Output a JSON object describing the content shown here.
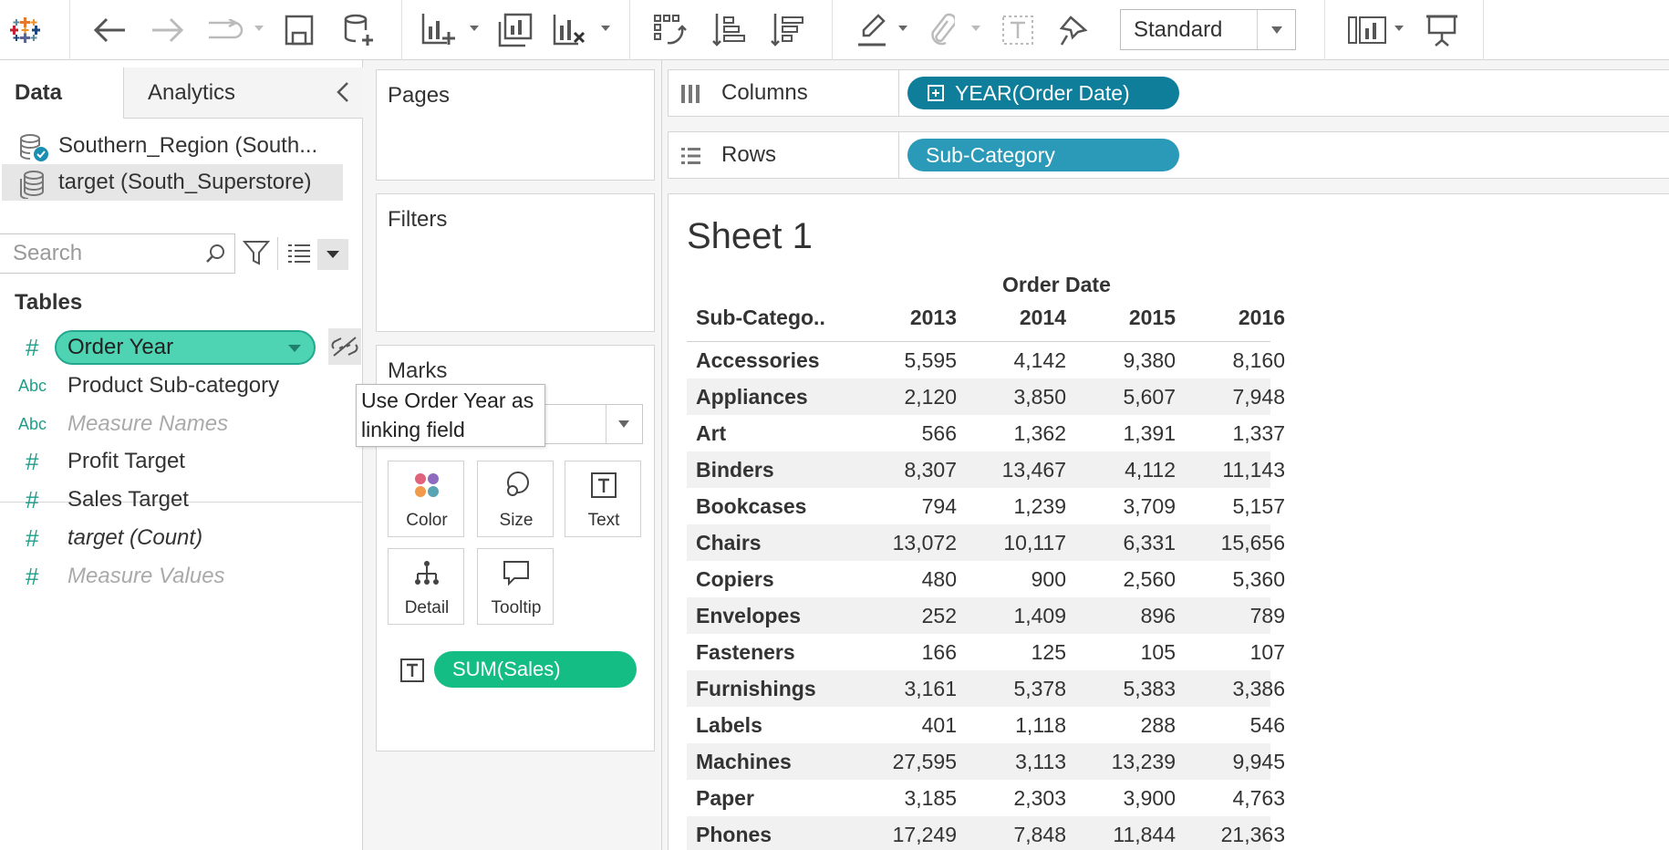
{
  "toolbar": {
    "fit_value": "Standard"
  },
  "data_pane": {
    "tabs": {
      "data": "Data",
      "analytics": "Analytics"
    },
    "datasources": [
      {
        "name": "Southern_Region (South..."
      },
      {
        "name": "target (South_Superstore)"
      }
    ],
    "search_placeholder": "Search",
    "tables_heading": "Tables",
    "fields": [
      {
        "type": "#",
        "name": "Order Year"
      },
      {
        "type": "Abc",
        "name": "Product Sub-category"
      },
      {
        "type": "Abc",
        "name": "Measure Names"
      },
      {
        "type": "#",
        "name": "Profit Target"
      },
      {
        "type": "#",
        "name": "Sales Target"
      },
      {
        "type": "#",
        "name": "target (Count)"
      },
      {
        "type": "#",
        "name": "Measure Values"
      }
    ]
  },
  "tooltip": {
    "line1": "Use Order Year as",
    "line2": "linking field"
  },
  "shelves": {
    "pages": "Pages",
    "filters": "Filters",
    "marks": "Marks",
    "mark_type": "Automatic",
    "mark_buttons": [
      "Color",
      "Size",
      "Text",
      "Detail",
      "Tooltip"
    ],
    "sum_pill": "SUM(Sales)"
  },
  "view": {
    "columns_label": "Columns",
    "columns_pill": "YEAR(Order Date)",
    "rows_label": "Rows",
    "rows_pill": "Sub-Category",
    "sheet_title": "Sheet 1",
    "column_title": "Order Date",
    "row_header": "Sub-Catego..",
    "years": [
      "2013",
      "2014",
      "2015",
      "2016"
    ],
    "rows": [
      {
        "cat": "Accessories",
        "vals": [
          "5,595",
          "4,142",
          "9,380",
          "8,160"
        ]
      },
      {
        "cat": "Appliances",
        "vals": [
          "2,120",
          "3,850",
          "5,607",
          "7,948"
        ]
      },
      {
        "cat": "Art",
        "vals": [
          "566",
          "1,362",
          "1,391",
          "1,337"
        ]
      },
      {
        "cat": "Binders",
        "vals": [
          "8,307",
          "13,467",
          "4,112",
          "11,143"
        ]
      },
      {
        "cat": "Bookcases",
        "vals": [
          "794",
          "1,239",
          "3,709",
          "5,157"
        ]
      },
      {
        "cat": "Chairs",
        "vals": [
          "13,072",
          "10,117",
          "6,331",
          "15,656"
        ]
      },
      {
        "cat": "Copiers",
        "vals": [
          "480",
          "900",
          "2,560",
          "5,360"
        ]
      },
      {
        "cat": "Envelopes",
        "vals": [
          "252",
          "1,409",
          "896",
          "789"
        ]
      },
      {
        "cat": "Fasteners",
        "vals": [
          "166",
          "125",
          "105",
          "107"
        ]
      },
      {
        "cat": "Furnishings",
        "vals": [
          "3,161",
          "5,378",
          "5,383",
          "3,386"
        ]
      },
      {
        "cat": "Labels",
        "vals": [
          "401",
          "1,118",
          "288",
          "546"
        ]
      },
      {
        "cat": "Machines",
        "vals": [
          "27,595",
          "3,113",
          "13,239",
          "9,945"
        ]
      },
      {
        "cat": "Paper",
        "vals": [
          "3,185",
          "2,303",
          "3,900",
          "4,763"
        ]
      },
      {
        "cat": "Phones",
        "vals": [
          "17,249",
          "7,848",
          "11,844",
          "21,363"
        ]
      }
    ]
  },
  "colors": {
    "dimension_pill": "#2a9ab8",
    "measure_pill": "#14bd83",
    "linked_field": "#4ed3b3"
  }
}
